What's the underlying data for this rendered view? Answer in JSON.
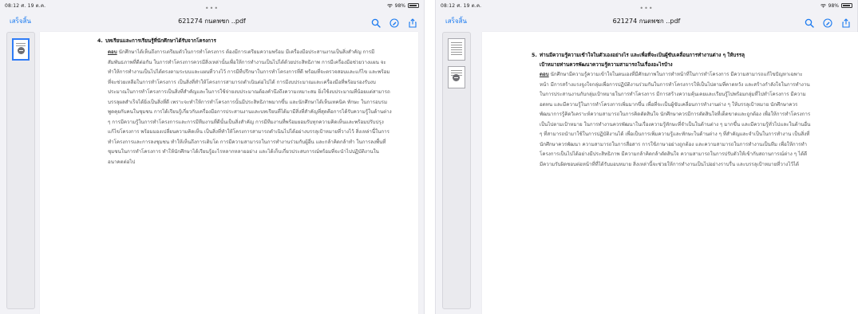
{
  "screens": [
    {
      "status_time": "08:12 ศ. 19 ต.ค.",
      "battery_text": "98%",
      "done_label": "เสร็จสิ้น",
      "title": "621274 กนตพชก ..pdf",
      "section_number": "4.",
      "section_heading": "บทเรียนและการเรียนรู้ที่นักศึกษาได้รับจากโครงการ",
      "paragraph_lead": "ตอบ",
      "paragraph_body": " นักศึกษาได้เห็นถึงการเตรียมตัวในการทำโครงการ ต้องมีการเตรียมความพร้อม มีเครื่องมือประสานงานเป็นสิ่งสำคัญ การมีสัมพันธภาพที่ดีต่อกัน ในการทำโครงการควรมีสิ่งเหล่านั้นเพื่อให้การทำงานเป็นไปได้ด้วยประสิทธิภาพ การมีเครื่องมือช่วยวางแผน จะทำให้การทำงานเป็นไปได้ตรงตามระบบและแผนที่วางไว้ การมีที่ปรึกษาในการทำโครงการที่ดี พร้อมที่จะตรวจสอบและแก้ไข และพร้อมที่จะช่วยเหลือในการทำโครงการ เป็นสิ่งที่ทำให้โครงการสามารถดำเนินต่อไปได้ การมีงบประมาณและเครื่องมือที่พร้อมรองรับงบประมาณในการทำโครงการเป็นสิ่งที่สำคัญและในการใช้จ่ายงบประมาณต้องคำนึงถึงความเหมาะสม ยิ่งใช้งบประมาณที่น้อยแต่สามารถบรรลุผลสำเร็จได้ยิ่งเป็นสิ่งที่ดี เพราะจะทำให้การทำโครงการนั้นมีประสิทธิภาพมากขึ้น และนักศึกษาได้เห็นเทคนิค ทักษะ ในการอบรมพูดคุยกับคนในชุมชน การได้เรียนรู้เกี่ยวกับเครื่องมือการประสานงานและบทเรียนที่ได้มามีสิ่งที่สำคัญที่สุดคือการได้รับความรู้ในด้านต่าง ๆ การมีความรู้ในการทำโครงการและการมีทีมงานที่ดีนั้นเป็นสิ่งสำคัญ การมีทีมงานที่พร้อมยอมรับทุกความคิดเห็นและพร้อมปรับปรุงแก้ไขโครงการ พร้อมมองเปลี่ยนความคิดเห็น เป็นสิ่งที่ทำให้โครงการสามารถดำเนินไปได้อย่างบรรลุเป้าหมายที่วางไว้ สิ่งเหล่านี้ในการทำโครงการและการลงชุมชน ทำให้เห็นถึงการเติบโต การมีความสามารถในการทำงานร่วมกับผู้อื่น และกล้าคิดกล้าทำ ในการลงพื้นที่ชุมชนในการทำโครงการ ทำให้นักศึกษาได้เรียนรู้อะไรหลากหลายอย่าง และได้เก็บเกี่ยวประสบการณ์พร้อมที่จะนำไปปฏิบัติงานในอนาคตต่อไป"
    },
    {
      "status_time": "08:12 ศ. 19 ต.ค.",
      "battery_text": "98%",
      "done_label": "เสร็จสิ้น",
      "title": "621274 กนตพชก ..pdf",
      "section_number": "5.",
      "section_heading": "ท่านมีความรู้ความเข้าใจในตัวเองอย่างไร และเพื่อที่จะเป็นผู้ขับเคลื่อนการทำงานต่าง ๆ ให้บรรลุ",
      "section_heading_2": "เป้าหมายท่านควรพัฒนาความรู้ความสามารถในเรื่องอะไรบ้าง",
      "paragraph_lead": "ตอบ",
      "paragraph_body": " นักศึกษามีความรู้ความเข้าใจในตนเองที่มีศักยภาพในการทำหน้าที่ในการทำโครงการ มีความสามารถแก้ไขปัญหาเฉพาะหน้า มีการสร้างแรงจูงใจกลุ่มเพื่อการปฏิบัติงานร่วมกันในการทำโครงการให้เป็นไปตามที่คาดหวัง และสร้างกำลังใจในการทำงาน ในการประสานงานกับกลุ่มเป้าหมายในการทำโครงการ มีการสร้างความคุ้นเคยและเรียนรู้ไปพร้อมกลุ่มที่ไปทำโครงการ มีความอดทน และมีความรู้ในการทำโครงการเพิ่มมากขึ้น เพื่อที่จะเป็นผู้ขับเคลื่อนการทำงานต่าง ๆ ให้บรรลุเป้าหมาย นักศึกษาควรพัฒนาการรู้คิดวิเคราะห์ความสามารถในการคิดตัดสินใจ นักศึกษาควรมีการตัดสินใจที่เด็ดขาดและถูกต้อง เพื่อให้การทำโครงการเป็นไปตามเป้าหมาย ในการทำงานควรพัฒนาในเรื่องความรู้ทักษะที่จำเป็นในด้านต่าง ๆ มากขึ้น และมีความรู้ทั่วไปและในด้านอื่น ๆ ที่สามารถนำมาใช้ในการปฏิบัติงานได้ เพื่อเป็นการเพิ่มความรู้และทักษะในด้านต่าง ๆ ที่สำคัญและจำเป็นในการทำงาน เป็นสิ่งที่นักศึกษาควรพัฒนา ความสามารถในการสื่อสาร การใช้ภาษาอย่างถูกต้อง และความสามารถในการทำงานเป็นทีม เพื่อให้การทำโครงการเป็นไปได้อย่างมีประสิทธิภาพ มีความกล้าคิดกล้าตัดสินใจ ความสามารถในการปรับตัวให้เข้ากับสถานการณ์ต่าง ๆ ได้ดี มีความรับผิดชอบต่อหน้าที่ที่ได้รับมอบหมาย สิ่งเหล่านี้จะช่วยให้การทำงานเป็นไปอย่างราบรื่น และบรรลุเป้าหมายที่วางไว้ได้"
    }
  ]
}
